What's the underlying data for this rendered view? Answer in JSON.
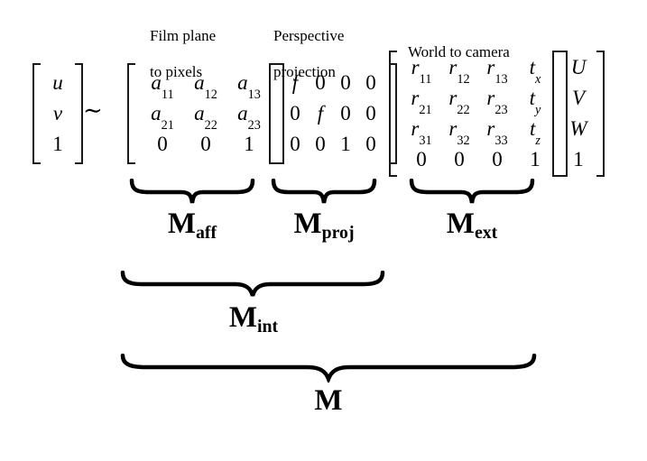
{
  "figure": {
    "type": "camera-projection-matrix-decomposition",
    "background_color": "#ffffff",
    "text_color": "#000000"
  },
  "captions": [
    {
      "id": "film-plane-to-pixels",
      "line1": "Film plane",
      "line2": "to pixels"
    },
    {
      "id": "perspective-projection",
      "line1": "Perspective",
      "line2": "projection"
    },
    {
      "id": "world-to-camera",
      "line1": "World to camera",
      "line2": ""
    }
  ],
  "relation": {
    "symbol": "∼",
    "name": "proportional-to"
  },
  "image_vector": {
    "name": "image-coordinates-vector",
    "rows": [
      [
        "u"
      ],
      [
        "v"
      ],
      [
        "1"
      ]
    ]
  },
  "affine_matrix": {
    "name": "affine-matrix",
    "label": "M_aff",
    "rows": [
      [
        {
          "base": "a",
          "sub": "11"
        },
        {
          "base": "a",
          "sub": "12"
        },
        {
          "base": "a",
          "sub": "13"
        }
      ],
      [
        {
          "base": "a",
          "sub": "21"
        },
        {
          "base": "a",
          "sub": "22"
        },
        {
          "base": "a",
          "sub": "23"
        }
      ],
      [
        {
          "base": "0",
          "sub": ""
        },
        {
          "base": "0",
          "sub": ""
        },
        {
          "base": "1",
          "sub": ""
        }
      ]
    ]
  },
  "projection_matrix": {
    "name": "perspective-projection-matrix",
    "label": "M_proj",
    "rows": [
      [
        "f",
        "0",
        "0",
        "0"
      ],
      [
        "0",
        "f",
        "0",
        "0"
      ],
      [
        "0",
        "0",
        "1",
        "0"
      ]
    ]
  },
  "extrinsic_matrix": {
    "name": "world-to-camera-matrix",
    "label": "M_ext",
    "rows": [
      [
        {
          "base": "r",
          "sub": "11"
        },
        {
          "base": "r",
          "sub": "12"
        },
        {
          "base": "r",
          "sub": "13"
        },
        {
          "base": "t",
          "sub": "x"
        }
      ],
      [
        {
          "base": "r",
          "sub": "21"
        },
        {
          "base": "r",
          "sub": "22"
        },
        {
          "base": "r",
          "sub": "23"
        },
        {
          "base": "t",
          "sub": "y"
        }
      ],
      [
        {
          "base": "r",
          "sub": "31"
        },
        {
          "base": "r",
          "sub": "32"
        },
        {
          "base": "r",
          "sub": "33"
        },
        {
          "base": "t",
          "sub": "z"
        }
      ],
      [
        {
          "base": "0",
          "sub": ""
        },
        {
          "base": "0",
          "sub": ""
        },
        {
          "base": "0",
          "sub": ""
        },
        {
          "base": "1",
          "sub": ""
        }
      ]
    ]
  },
  "world_vector": {
    "name": "world-coordinates-vector",
    "rows": [
      [
        "U"
      ],
      [
        "V"
      ],
      [
        "W"
      ],
      [
        "1"
      ]
    ]
  },
  "brace_labels": {
    "aff": {
      "base": "M",
      "sub": "aff"
    },
    "proj": {
      "base": "M",
      "sub": "proj"
    },
    "ext": {
      "base": "M",
      "sub": "ext"
    },
    "int": {
      "base": "M",
      "sub": "int"
    },
    "total": {
      "base": "M",
      "sub": ""
    }
  }
}
